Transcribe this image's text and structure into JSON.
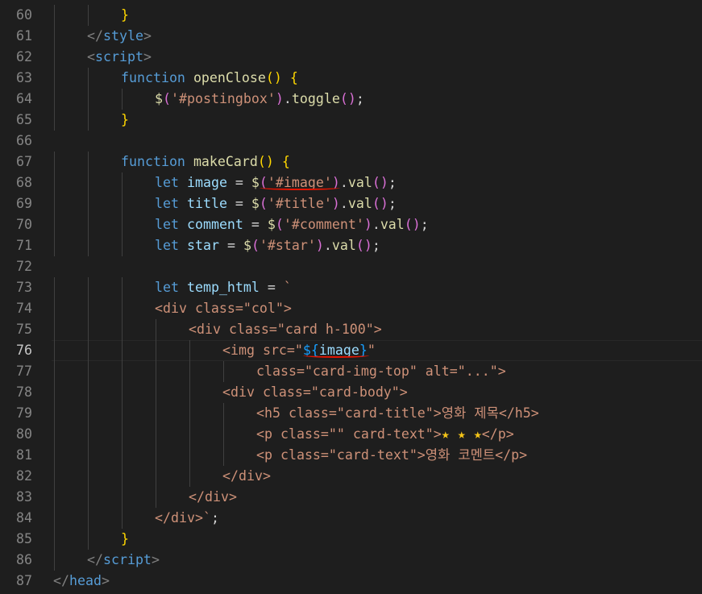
{
  "editor": {
    "lines": [
      {
        "num": "60",
        "indent": 2,
        "tokens": [
          [
            "}",
            "t-b1"
          ]
        ]
      },
      {
        "num": "61",
        "indent": 1,
        "tokens": [
          [
            "</",
            "t-tag"
          ],
          [
            "style",
            "t-name"
          ],
          [
            ">",
            "t-tag"
          ]
        ]
      },
      {
        "num": "62",
        "indent": 1,
        "tokens": [
          [
            "<",
            "t-tag"
          ],
          [
            "script",
            "t-name"
          ],
          [
            ">",
            "t-tag"
          ]
        ]
      },
      {
        "num": "63",
        "indent": 2,
        "tokens": [
          [
            "function",
            "t-kw"
          ],
          [
            " ",
            "t-plain"
          ],
          [
            "openClose",
            "t-fn"
          ],
          [
            "()",
            "t-b1"
          ],
          [
            " ",
            "t-plain"
          ],
          [
            "{",
            "t-b1"
          ]
        ]
      },
      {
        "num": "64",
        "indent": 3,
        "tokens": [
          [
            "$",
            "t-fn"
          ],
          [
            "(",
            "t-b2"
          ],
          [
            "'#postingbox'",
            "t-str"
          ],
          [
            ")",
            "t-b2"
          ],
          [
            ".",
            "t-plain"
          ],
          [
            "toggle",
            "t-fn"
          ],
          [
            "()",
            "t-b2"
          ],
          [
            ";",
            "t-plain"
          ]
        ]
      },
      {
        "num": "65",
        "indent": 2,
        "tokens": [
          [
            "}",
            "t-b1"
          ]
        ]
      },
      {
        "num": "66",
        "indent": 0,
        "tokens": []
      },
      {
        "num": "67",
        "indent": 2,
        "tokens": [
          [
            "function",
            "t-kw"
          ],
          [
            " ",
            "t-plain"
          ],
          [
            "makeCard",
            "t-fn"
          ],
          [
            "()",
            "t-b1"
          ],
          [
            " ",
            "t-plain"
          ],
          [
            "{",
            "t-b1"
          ]
        ]
      },
      {
        "num": "68",
        "indent": 3,
        "tokens": [
          [
            "let",
            "t-kw"
          ],
          [
            " ",
            "t-plain"
          ],
          [
            "image",
            "t-var"
          ],
          [
            " = ",
            "t-plain"
          ],
          [
            "$",
            "t-fn"
          ],
          [
            "(",
            "t-b2"
          ],
          [
            "'#image'",
            "t-str"
          ],
          [
            ")",
            "t-b2"
          ],
          [
            ".",
            "t-plain"
          ],
          [
            "val",
            "t-fn"
          ],
          [
            "()",
            "t-b2"
          ],
          [
            ";",
            "t-plain"
          ]
        ]
      },
      {
        "num": "69",
        "indent": 3,
        "tokens": [
          [
            "let",
            "t-kw"
          ],
          [
            " ",
            "t-plain"
          ],
          [
            "title",
            "t-var"
          ],
          [
            " = ",
            "t-plain"
          ],
          [
            "$",
            "t-fn"
          ],
          [
            "(",
            "t-b2"
          ],
          [
            "'#title'",
            "t-str"
          ],
          [
            ")",
            "t-b2"
          ],
          [
            ".",
            "t-plain"
          ],
          [
            "val",
            "t-fn"
          ],
          [
            "()",
            "t-b2"
          ],
          [
            ";",
            "t-plain"
          ]
        ]
      },
      {
        "num": "70",
        "indent": 3,
        "tokens": [
          [
            "let",
            "t-kw"
          ],
          [
            " ",
            "t-plain"
          ],
          [
            "comment",
            "t-var"
          ],
          [
            " = ",
            "t-plain"
          ],
          [
            "$",
            "t-fn"
          ],
          [
            "(",
            "t-b2"
          ],
          [
            "'#comment'",
            "t-str"
          ],
          [
            ")",
            "t-b2"
          ],
          [
            ".",
            "t-plain"
          ],
          [
            "val",
            "t-fn"
          ],
          [
            "()",
            "t-b2"
          ],
          [
            ";",
            "t-plain"
          ]
        ]
      },
      {
        "num": "71",
        "indent": 3,
        "tokens": [
          [
            "let",
            "t-kw"
          ],
          [
            " ",
            "t-plain"
          ],
          [
            "star",
            "t-var"
          ],
          [
            " = ",
            "t-plain"
          ],
          [
            "$",
            "t-fn"
          ],
          [
            "(",
            "t-b2"
          ],
          [
            "'#star'",
            "t-str"
          ],
          [
            ")",
            "t-b2"
          ],
          [
            ".",
            "t-plain"
          ],
          [
            "val",
            "t-fn"
          ],
          [
            "()",
            "t-b2"
          ],
          [
            ";",
            "t-plain"
          ]
        ]
      },
      {
        "num": "72",
        "indent": 0,
        "tokens": []
      },
      {
        "num": "73",
        "indent": 3,
        "tokens": [
          [
            "let",
            "t-kw"
          ],
          [
            " ",
            "t-plain"
          ],
          [
            "temp_html",
            "t-var"
          ],
          [
            " = ",
            "t-plain"
          ],
          [
            "`",
            "t-str"
          ]
        ]
      },
      {
        "num": "74",
        "indent": 3,
        "tokens": [
          [
            "<div class=\"col\">",
            "t-str"
          ]
        ]
      },
      {
        "num": "75",
        "indent": 4,
        "tokens": [
          [
            "<div class=\"card h-100\">",
            "t-str"
          ]
        ]
      },
      {
        "num": "76",
        "indent": 5,
        "active": true,
        "tokens": [
          [
            "<img src=\"",
            "t-str"
          ],
          [
            "${",
            "t-b3"
          ],
          [
            "image",
            "t-var"
          ],
          [
            "}",
            "t-b3"
          ],
          [
            "\"",
            "t-str"
          ]
        ]
      },
      {
        "num": "77",
        "indent": 6,
        "tokens": [
          [
            "class=\"card-img-top\" alt=\"...\">",
            "t-str"
          ]
        ]
      },
      {
        "num": "78",
        "indent": 5,
        "tokens": [
          [
            "<div class=\"card-body\">",
            "t-str"
          ]
        ]
      },
      {
        "num": "79",
        "indent": 6,
        "tokens": [
          [
            "<h5 class=\"card-title\">영화 제목</h5>",
            "t-str"
          ]
        ]
      },
      {
        "num": "80",
        "indent": 6,
        "tokens": [
          [
            "<p class=\"\" card-text\">",
            "t-str"
          ],
          [
            "★ ★ ★",
            "t-star"
          ],
          [
            "</p>",
            "t-str"
          ]
        ]
      },
      {
        "num": "81",
        "indent": 6,
        "tokens": [
          [
            "<p class=\"card-text\">영화 코멘트</p>",
            "t-str"
          ]
        ]
      },
      {
        "num": "82",
        "indent": 5,
        "tokens": [
          [
            "</div>",
            "t-str"
          ]
        ]
      },
      {
        "num": "83",
        "indent": 4,
        "tokens": [
          [
            "</div>",
            "t-str"
          ]
        ]
      },
      {
        "num": "84",
        "indent": 3,
        "tokens": [
          [
            "</div>`",
            "t-str"
          ],
          [
            ";",
            "t-plain"
          ]
        ]
      },
      {
        "num": "85",
        "indent": 2,
        "tokens": [
          [
            "}",
            "t-b1"
          ]
        ]
      },
      {
        "num": "86",
        "indent": 1,
        "tokens": [
          [
            "</",
            "t-tag"
          ],
          [
            "script",
            "t-name"
          ],
          [
            ">",
            "t-tag"
          ]
        ]
      },
      {
        "num": "87",
        "indent": 0,
        "tokens": [
          [
            "</",
            "t-tag"
          ],
          [
            "head",
            "t-name"
          ],
          [
            ">",
            "t-tag"
          ]
        ]
      }
    ]
  },
  "colors": {
    "background": "#1e1e1e",
    "line_number": "#858585",
    "squiggle": "#e51400"
  }
}
